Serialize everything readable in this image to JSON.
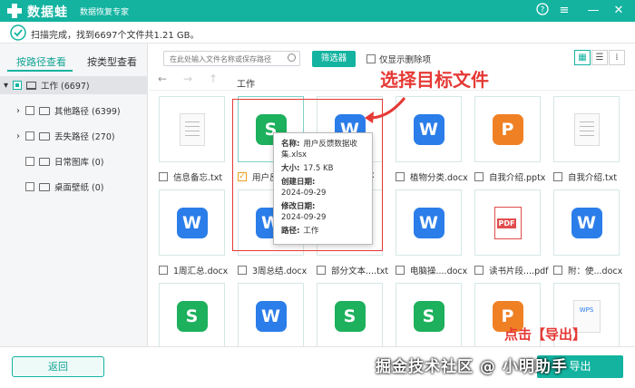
{
  "app": {
    "title": "数据蛙",
    "subtitle": "数据恢复专家"
  },
  "status": {
    "text": "扫描完成，找到6697个文件共1.21 GB。"
  },
  "tabs": {
    "by_path": "按路径查看",
    "by_type": "按类型查看"
  },
  "tree": [
    {
      "label": "工作 (6697)"
    },
    {
      "label": "其他路径 (6399)"
    },
    {
      "label": "丢失路径 (270)"
    },
    {
      "label": "日常图库 (0)"
    },
    {
      "label": "桌面壁纸 (0)"
    }
  ],
  "toolbar": {
    "search_placeholder": "在此处输入文件名称或保存路径",
    "filter_label": "筛选器",
    "show_deleted_label": "仅显示删除项"
  },
  "breadcrumb": "工作",
  "files": [
    {
      "name": "信息备忘.txt",
      "type": "txt"
    },
    {
      "name": "用户反",
      "type": "s",
      "checked": true
    },
    {
      "name": "ocx",
      "type": "w"
    },
    {
      "name": "植物分类.docx",
      "type": "w"
    },
    {
      "name": "自我介绍.pptx",
      "type": "p"
    },
    {
      "name": "自我介绍.txt",
      "type": "txt"
    },
    {
      "name": "1周汇总.docx",
      "type": "w"
    },
    {
      "name": "3周总结.docx",
      "type": "w"
    },
    {
      "name": "部分文本....txt",
      "type": "w"
    },
    {
      "name": "电脑操....docx",
      "type": "w"
    },
    {
      "name": "读书片段....pdf",
      "type": "pdf"
    },
    {
      "name": "附：使...docx",
      "type": "w"
    },
    {
      "name": "",
      "type": "s"
    },
    {
      "name": "",
      "type": "w"
    },
    {
      "name": "",
      "type": "s"
    },
    {
      "name": "",
      "type": "s"
    },
    {
      "name": "",
      "type": "p"
    },
    {
      "name": "",
      "type": "wps"
    }
  ],
  "icons": {
    "s": "S",
    "w": "W",
    "p": "P",
    "pdf": "PDF",
    "wps": "WPS"
  },
  "tooltip": {
    "name_label": "名称:",
    "name_value": "用户反馈数据收集.xlsx",
    "size_label": "大小:",
    "size_value": "17.5 KB",
    "created_label": "创建日期:",
    "created_value": "2024-09-29",
    "modified_label": "修改日期:",
    "modified_value": "2024-09-29",
    "path_label": "路径:",
    "path_value": "工作"
  },
  "annotations": {
    "select_target": "选择目标文件",
    "click_export": "点击【导出】"
  },
  "footer": {
    "back_label": "返回",
    "export_label": "导出"
  },
  "watermark": "掘金技术社区 @ 小明助手",
  "colors": {
    "accent": "#13b3a0",
    "annotation": "#e53935"
  }
}
